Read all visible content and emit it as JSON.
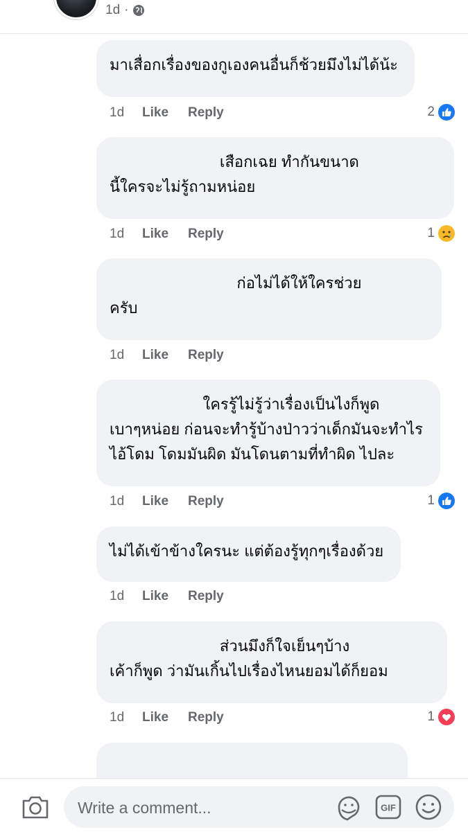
{
  "post": {
    "time": "1d",
    "separator": "·"
  },
  "comments": [
    {
      "text": "มาเสื่อกเรื่องของกูเองคนอื่นก็ช้วยมึงไม่ได้น้ะ",
      "time": "1d",
      "like": "Like",
      "reply": "Reply",
      "reaction_count": "2",
      "reaction": "like"
    },
    {
      "text": "                          เสือกเฉย ทำกันขนาด\nนี้ใครจะไม่รู้ถามหน่อย",
      "time": "1d",
      "like": "Like",
      "reply": "Reply",
      "reaction_count": "1",
      "reaction": "sad"
    },
    {
      "text": "                              ก่อไม่ได้ให้ใครช่วย\nครับ",
      "time": "1d",
      "like": "Like",
      "reply": "Reply",
      "reaction_count": "",
      "reaction": ""
    },
    {
      "text": "                      ใครรู้ไม่รู้ว่าเรื่องเป็นไงก็พูด\nเบาๆหน่อย ก่อนจะทำรู้บ้างป่าวว่าเด็กมันจะทำไร\nไอ้โดม โดมมันผิด มันโดนตามที่ทำผิด ไปละ",
      "time": "1d",
      "like": "Like",
      "reply": "Reply",
      "reaction_count": "1",
      "reaction": "like"
    },
    {
      "text": "ไม่ได้เข้าข้างใครนะ แต่ต้องรู้ทุกๆเรื่องด้วย",
      "time": "1d",
      "like": "Like",
      "reply": "Reply",
      "reaction_count": "",
      "reaction": ""
    },
    {
      "text": "                          ส่วนมึงก็ใจเย็นๆบ้าง\nเค้าก็พูด ว่ามันเกิ้นไปเรื่องไหนยอมได้ก็ยอม",
      "time": "1d",
      "like": "Like",
      "reply": "Reply",
      "reaction_count": "1",
      "reaction": "love"
    }
  ],
  "composer": {
    "placeholder": "Write a comment..."
  },
  "icons": {
    "back": "chevron-left-icon",
    "privacy": "globe-icon",
    "camera": "camera-icon",
    "sticker": "sticker-icon",
    "gif": "gif-icon",
    "emoji": "emoji-icon"
  },
  "colors": {
    "like_blue": "#1877f2",
    "love_red": "#f33e58",
    "sad_yellow": "#f7b928",
    "bubble_bg": "#f0f2f5",
    "meta_text": "#65676b"
  }
}
